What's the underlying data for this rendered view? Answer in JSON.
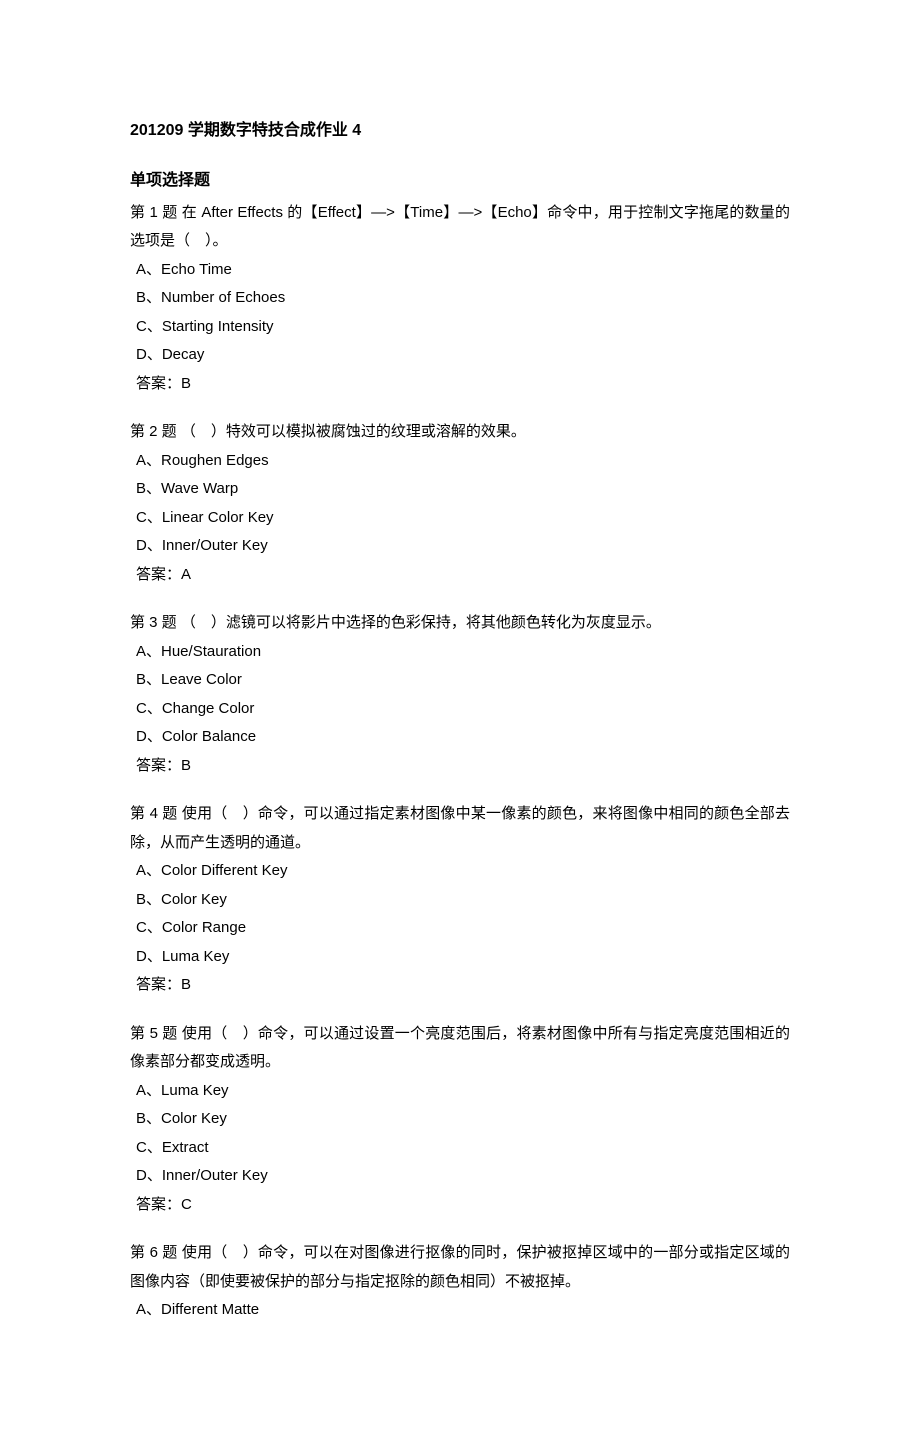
{
  "title": "201209 学期数字特技合成作业 4",
  "section_header": "单项选择题",
  "answer_label": "答案：",
  "questions": [
    {
      "stem": "第 1 题  在 After Effects 的【Effect】—>【Time】—>【Echo】命令中，用于控制文字拖尾的数量的选项是（　）。",
      "opts": [
        "A、Echo Time",
        "B、Number of Echoes",
        "C、Starting Intensity",
        "D、Decay"
      ],
      "answer": "B"
    },
    {
      "stem": "第 2 题  （　）特效可以模拟被腐蚀过的纹理或溶解的效果。",
      "opts": [
        "A、Roughen Edges",
        "B、Wave Warp",
        "C、Linear Color Key",
        "D、Inner/Outer Key"
      ],
      "answer": "A"
    },
    {
      "stem": "第 3 题  （　）滤镜可以将影片中选择的色彩保持，将其他颜色转化为灰度显示。",
      "opts": [
        "A、Hue/Stauration",
        "B、Leave Color",
        "C、Change Color",
        "D、Color Balance"
      ],
      "answer": "B"
    },
    {
      "stem": "第 4 题  使用（　）命令，可以通过指定素材图像中某一像素的颜色，来将图像中相同的颜色全部去除，从而产生透明的通道。",
      "opts": [
        "A、Color Different Key",
        "B、Color Key",
        "C、Color Range",
        "D、Luma Key"
      ],
      "answer": "B"
    },
    {
      "stem": "第 5 题  使用（　）命令，可以通过设置一个亮度范围后，将素材图像中所有与指定亮度范围相近的像素部分都变成透明。",
      "opts": [
        "A、Luma Key",
        "B、Color Key",
        "C、Extract",
        "D、Inner/Outer Key"
      ],
      "answer": "C"
    },
    {
      "stem": "第 6 题  使用（　）命令，可以在对图像进行抠像的同时，保护被抠掉区域中的一部分或指定区域的图像内容（即使要被保护的部分与指定抠除的颜色相同）不被抠掉。",
      "opts": [
        "A、Different Matte"
      ],
      "answer": null
    }
  ]
}
